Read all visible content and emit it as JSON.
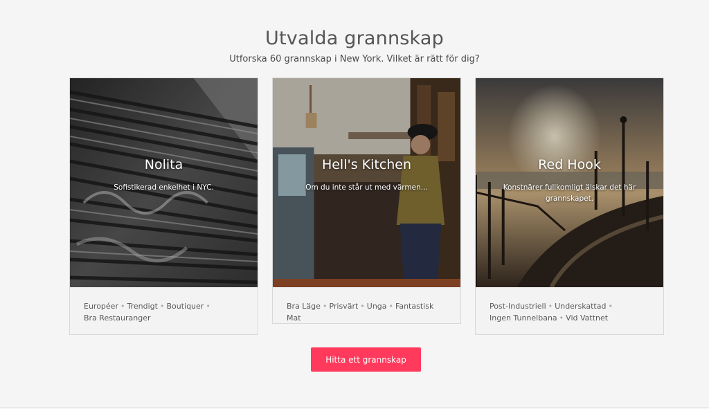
{
  "header": {
    "title": "Utvalda grannskap",
    "subtitle": "Utforska 60 grannskap i New York. Vilket är rätt för dig?"
  },
  "neighborhoods": [
    {
      "name": "Nolita",
      "description": "Sofistikerad enkelhet i NYC.",
      "tags_line1": [
        "Européer",
        "Trendigt",
        "Boutiquer"
      ],
      "tags_line2": [
        "Bra Restauranger"
      ]
    },
    {
      "name": "Hell's Kitchen",
      "description": "Om du inte står ut med värmen...",
      "tags_line1": [
        "Bra Läge",
        "Prisvärt",
        "Unga",
        "Fantastisk Mat"
      ],
      "tags_line2": []
    },
    {
      "name": "Red Hook",
      "description": "Konstnärer fullkomligt älskar det här grannskapet.",
      "tags_line1": [
        "Post-Industriell",
        "Underskattad"
      ],
      "tags_line2": [
        "Ingen Tunnelbana",
        "Vid Vattnet"
      ]
    }
  ],
  "cta": {
    "label": "Hitta ett grannskap"
  },
  "colors": {
    "accent": "#ff3a5c",
    "background": "#f5f5f5"
  }
}
